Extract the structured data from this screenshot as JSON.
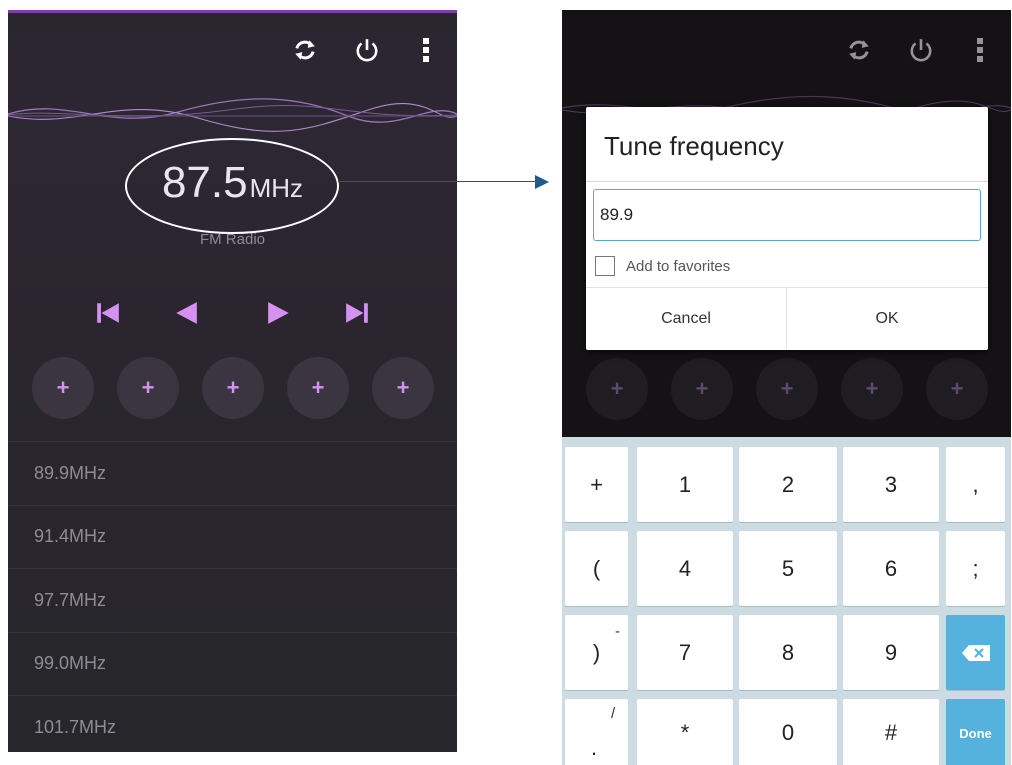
{
  "left_screen": {
    "toolbar": {
      "refresh_icon": "refresh-icon",
      "power_icon": "power-icon",
      "menu_icon": "more-vert-icon"
    },
    "frequency": {
      "value": "87.5",
      "unit": "MHz"
    },
    "band_label": "FM Radio",
    "controls": [
      "skip-previous-icon",
      "seek-back-icon",
      "seek-forward-icon",
      "skip-next-icon"
    ],
    "presets": [
      "+",
      "+",
      "+",
      "+",
      "+"
    ],
    "stations": [
      {
        "value": "89.9",
        "unit": "MHz"
      },
      {
        "value": "91.4",
        "unit": "MHz"
      },
      {
        "value": "97.7",
        "unit": "MHz"
      },
      {
        "value": "99.0",
        "unit": "MHz"
      },
      {
        "value": "101.7",
        "unit": "MHz"
      }
    ]
  },
  "right_screen": {
    "presets": [
      "+",
      "+",
      "+",
      "+",
      "+"
    ],
    "dialog": {
      "title": "Tune frequency",
      "input_value": "89.9",
      "checkbox_label": "Add to favorites",
      "checkbox_checked": false,
      "cancel_label": "Cancel",
      "ok_label": "OK"
    },
    "keyboard": {
      "row1": [
        "+",
        "1",
        "2",
        "3",
        ","
      ],
      "row2": [
        "(",
        "4",
        "5",
        "6",
        ";"
      ],
      "row3": [
        ")",
        "7",
        "8",
        "9"
      ],
      "row3_sup": "-",
      "row4": [
        ".",
        "*",
        "0",
        "#"
      ],
      "row4_sup": "/",
      "done_label": "Done",
      "backspace_icon": "backspace-icon"
    }
  },
  "colors": {
    "accent": "#d690f2",
    "dialog_input_border": "#5aa5d4",
    "keyboard_action": "#55b1dd",
    "arrow": "#1e5a8c"
  }
}
